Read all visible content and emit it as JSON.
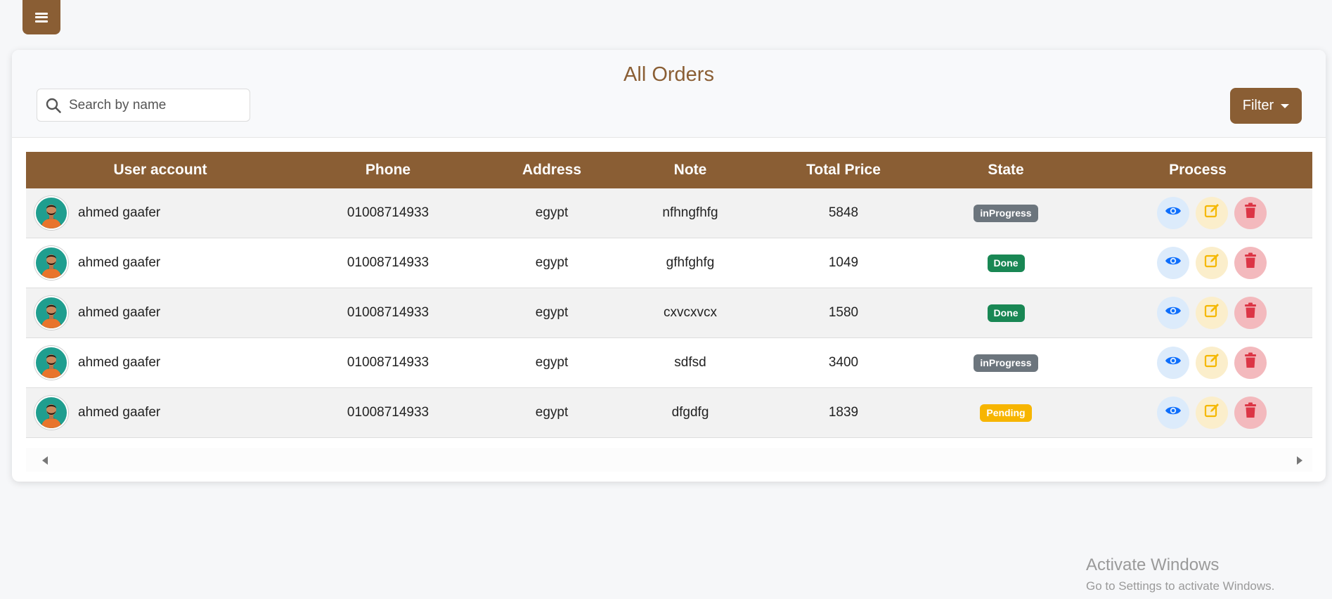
{
  "menu": {
    "icon": "hamburger-icon"
  },
  "header": {
    "title": "All Orders",
    "search_placeholder": "Search by name",
    "filter_label": "Filter"
  },
  "table": {
    "columns": [
      "User account",
      "Phone",
      "Address",
      "Note",
      "Total Price",
      "State",
      "Process"
    ],
    "rows": [
      {
        "user": "ahmed gaafer",
        "phone": "01008714933",
        "address": "egypt",
        "note": "nfhngfhfg",
        "total": "5848",
        "state": "inProgress"
      },
      {
        "user": "ahmed gaafer",
        "phone": "01008714933",
        "address": "egypt",
        "note": "gfhfghfg",
        "total": "1049",
        "state": "Done"
      },
      {
        "user": "ahmed gaafer",
        "phone": "01008714933",
        "address": "egypt",
        "note": "cxvcxvcx",
        "total": "1580",
        "state": "Done"
      },
      {
        "user": "ahmed gaafer",
        "phone": "01008714933",
        "address": "egypt",
        "note": "sdfsd",
        "total": "3400",
        "state": "inProgress"
      },
      {
        "user": "ahmed gaafer",
        "phone": "01008714933",
        "address": "egypt",
        "note": "dfgdfg",
        "total": "1839",
        "state": "Pending"
      }
    ],
    "actions": [
      "eye-icon",
      "edit-icon",
      "trash-icon"
    ]
  },
  "colors": {
    "brand": "#8a5e34",
    "inProgress": "#6c757d",
    "Done": "#198754",
    "Pending": "#f7b500",
    "view": "#0d6efd",
    "edit": "#f5b800",
    "delete": "#dc3545"
  },
  "watermark": {
    "title": "Activate Windows",
    "subtitle": "Go to Settings to activate Windows."
  }
}
